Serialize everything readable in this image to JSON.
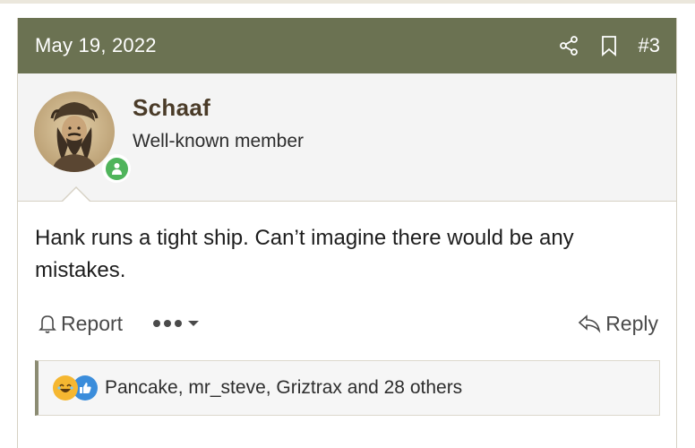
{
  "post": {
    "date": "May 19, 2022",
    "number": "#3",
    "icons": {
      "share": "share-icon",
      "bookmark": "bookmark-icon"
    }
  },
  "user": {
    "name": "Schaaf",
    "title": "Well-known member",
    "online_color": "#4fb45b"
  },
  "body": {
    "text": "Hank runs a tight ship. Can’t imagine there would be any mistakes."
  },
  "actions": {
    "report_label": "Report",
    "reply_label": "Reply"
  },
  "reactions": {
    "types": [
      "laugh-reaction-icon",
      "like-reaction-icon"
    ],
    "summary": "Pancake, mr_steve, Griztrax and 28 others"
  },
  "colors": {
    "header_bg": "#6b7252",
    "username": "#4a3b28",
    "laugh": "#f5b731",
    "like": "#3b8ddb"
  }
}
